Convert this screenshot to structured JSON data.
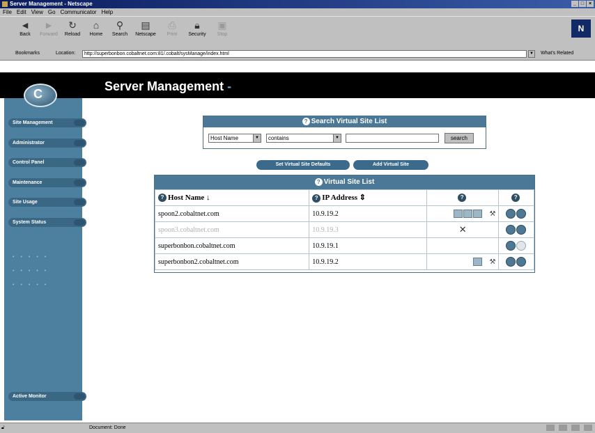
{
  "window": {
    "title": "Server Management - Netscape"
  },
  "menu": [
    "File",
    "Edit",
    "View",
    "Go",
    "Communicator",
    "Help"
  ],
  "toolbar": [
    {
      "label": "Back",
      "icon": "back-arrow-icon",
      "enabled": true
    },
    {
      "label": "Forward",
      "icon": "forward-arrow-icon",
      "enabled": false
    },
    {
      "label": "Reload",
      "icon": "reload-icon",
      "enabled": true
    },
    {
      "label": "Home",
      "icon": "home-icon",
      "enabled": true
    },
    {
      "label": "Search",
      "icon": "search-icon",
      "enabled": true
    },
    {
      "label": "Netscape",
      "icon": "netscape-icon",
      "enabled": true
    },
    {
      "label": "Print",
      "icon": "print-icon",
      "enabled": false
    },
    {
      "label": "Security",
      "icon": "lock-icon",
      "enabled": true
    },
    {
      "label": "Stop",
      "icon": "stop-icon",
      "enabled": false
    }
  ],
  "location": {
    "bookmarks": "Bookmarks",
    "label": "Location:",
    "url": "http://superbonbon.cobaltnet.com:81/.cobalt/sysManage/index.html",
    "related": "What's Related"
  },
  "page": {
    "title": "Server Management",
    "title_suffix": "-"
  },
  "sidebar": {
    "items": [
      "Site Management",
      "Administrator",
      "Control Panel",
      "Maintenance",
      "Site Usage",
      "System Status"
    ],
    "bottom": "Active Monitor"
  },
  "search": {
    "header": "Search Virtual Site List",
    "field": "Host Name",
    "op": "contains",
    "value": "",
    "button": "search"
  },
  "actions": {
    "defaults": "Set Virtual Site Defaults",
    "add": "Add Virtual Site"
  },
  "list": {
    "header": "Virtual Site List",
    "col_host": "Host Name",
    "col_ip": "IP Address",
    "rows": [
      {
        "host": "spoon2.cobaltnet.com",
        "ip": "10.9.19.2",
        "suspended": false
      },
      {
        "host": "spoon3.cobaltnet.com",
        "ip": "10.9.19.3",
        "suspended": true
      },
      {
        "host": "superbonbon.cobaltnet.com",
        "ip": "10.9.19.1",
        "suspended": false
      },
      {
        "host": "superbonbon2.cobaltnet.com",
        "ip": "10.9.19.2",
        "suspended": false
      }
    ]
  },
  "status": {
    "text": "Document: Done"
  },
  "colors": {
    "sidebar": "#4d7f9e",
    "panel_header": "#4b7896",
    "header_bg": "#000000"
  }
}
